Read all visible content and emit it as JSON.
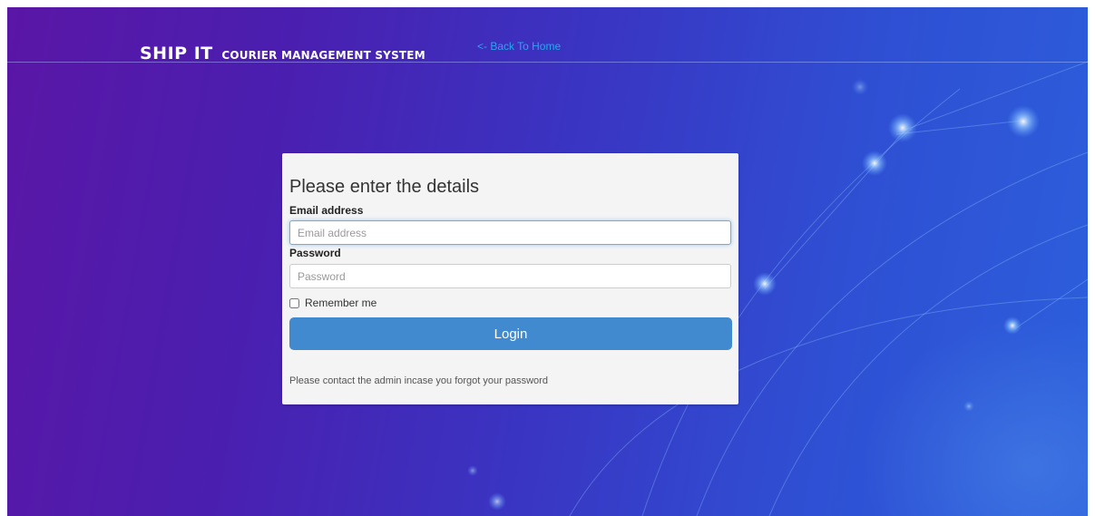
{
  "header": {
    "brand_main": "SHIP IT",
    "brand_sub": "COURIER MANAGEMENT SYSTEM",
    "back_link": "<- Back To Home"
  },
  "login_form": {
    "title": "Please enter the details",
    "email_label": "Email address",
    "email_placeholder": "Email address",
    "email_value": "",
    "password_label": "Password",
    "password_placeholder": "Password",
    "password_value": "",
    "remember_label": "Remember me",
    "remember_checked": false,
    "login_label": "Login",
    "help_text": "Please contact the admin incase you forgot your password"
  },
  "colors": {
    "background_start": "#5a16a6",
    "background_end": "#2c5fdc",
    "link": "#27a7ee",
    "button": "#418ad0",
    "card": "#f4f4f4"
  },
  "icons": {
    "checkbox": "checkbox-icon"
  }
}
